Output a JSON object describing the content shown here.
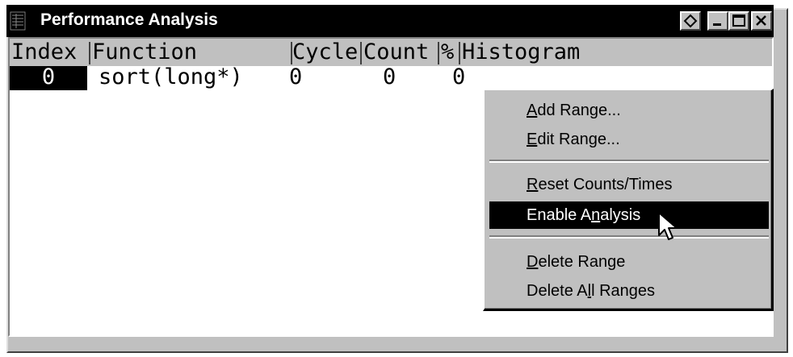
{
  "window": {
    "title": "Performance Analysis"
  },
  "title_buttons": [
    {
      "name": "float-window-button",
      "icon": "diamond-icon"
    },
    {
      "name": "minimize-button",
      "icon": "minimize-icon"
    },
    {
      "name": "maximize-button",
      "icon": "maximize-icon"
    },
    {
      "name": "close-button",
      "icon": "close-icon"
    }
  ],
  "columns": [
    "Index",
    "Function",
    "Cycle",
    "Count",
    "%",
    "Histogram"
  ],
  "rows": [
    {
      "index": "0",
      "function": "sort(long*)",
      "cycle": "0",
      "count": "0",
      "percent": "0",
      "histogram": ""
    }
  ],
  "context_menu": {
    "items": [
      {
        "pre": "",
        "u": "A",
        "post": "dd Range..."
      },
      {
        "pre": "",
        "u": "E",
        "post": "dit Range..."
      },
      {
        "pre": "",
        "u": "R",
        "post": "eset Counts/Times"
      },
      {
        "pre": "Enable A",
        "u": "n",
        "post": "alysis"
      },
      {
        "pre": "",
        "u": "D",
        "post": "elete Range"
      },
      {
        "pre": "Delete A",
        "u": "l",
        "post": "l Ranges"
      }
    ],
    "highlighted_index": 3
  }
}
